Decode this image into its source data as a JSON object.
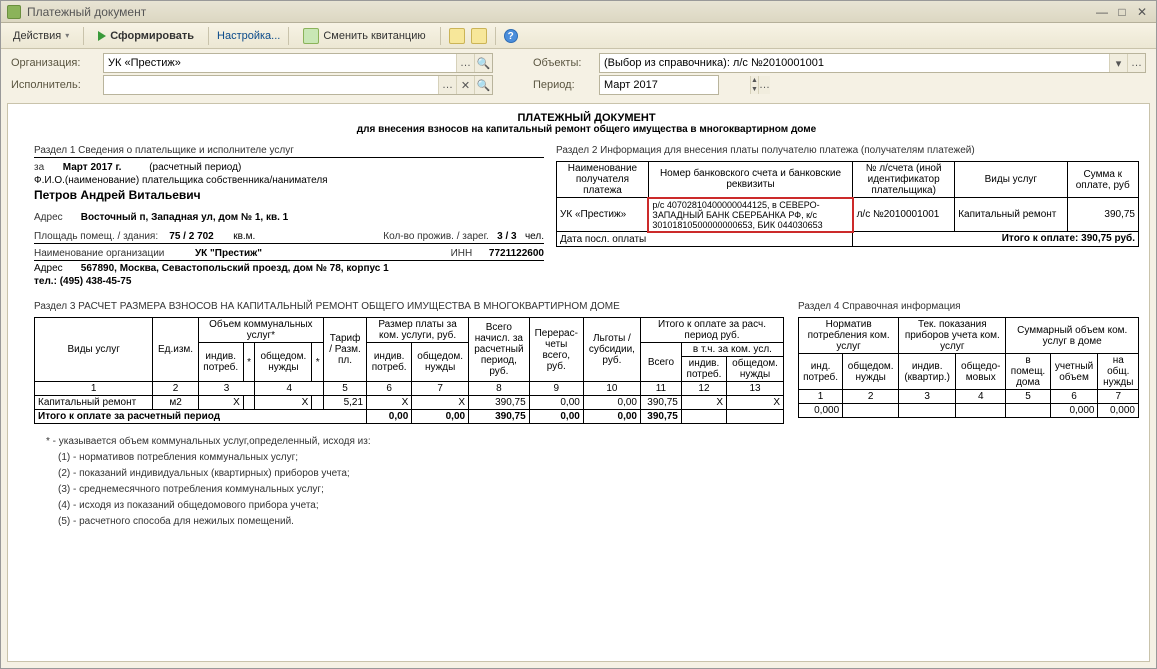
{
  "window": {
    "title": "Платежный документ"
  },
  "toolbar": {
    "actions": "Действия",
    "form": "Сформировать",
    "settings": "Настройка...",
    "change_receipt": "Сменить квитанцию"
  },
  "form": {
    "org_label": "Организация:",
    "org_value": "УК «Престиж»",
    "executor_label": "Исполнитель:",
    "executor_value": "",
    "objects_label": "Объекты:",
    "objects_value": "(Выбор из справочника): л/с №2010001001",
    "period_label": "Период:",
    "period_value": "Март 2017"
  },
  "doc": {
    "title": "ПЛАТЕЖНЫЙ ДОКУМЕНТ",
    "subtitle": "для внесения взносов на капитальный ремонт общего имущества в многоквартирном доме",
    "s1_title": "Раздел 1    Сведения о плательщике и исполнителе услуг",
    "s2_title": "Раздел 2     Информация для внесения платы получателю платежа (получателям платежей)",
    "s3_title": "Раздел 3   РАСЧЕТ РАЗМЕРА ВЗНОСОВ НА КАПИТАЛЬНЫЙ РЕМОНТ ОБЩЕГО ИМУЩЕСТВА В МНОГОКВАРТИРНОМ ДОМЕ",
    "s4_title": "Раздел 4     Справочная информация",
    "payer": {
      "za": "за",
      "period": "Март 2017 г.",
      "period_note": "(расчетный период)",
      "fio_label": "Ф.И.О.(наименование) плательщика собственника/нанимателя",
      "fio": "Петров Андрей Витальевич",
      "addr_label": "Адрес",
      "addr": "Восточный п, Западная ул, дом № 1, кв. 1",
      "area_label": "Площадь помещ. / здания:",
      "area": "75 / 2 702",
      "area_unit": "кв.м.",
      "people_label": "Кол-во прожив. / зарег.",
      "people": "3 / 3",
      "people_unit": "чел.",
      "org_label": "Наименование организации",
      "org": "УК \"Престиж\"",
      "inn_label": "ИНН",
      "inn": "7721122600",
      "addr2_label": "Адрес",
      "addr2": "567890, Москва, Севастопольский проезд, дом № 78, корпус 1",
      "tel_label": "тел.:",
      "tel": "(495) 438-45-75"
    },
    "s2_table": {
      "h1": "Наименование получателя платежа",
      "h2": "Номер банковского счета и банковские реквизиты",
      "h3": "№ л/счета (иной идентификатор плательщика)",
      "h4": "Виды услуг",
      "h5": "Сумма к оплате, руб",
      "r1c1": "УК «Престиж»",
      "r1c2": "р/с 40702810400000044125, в СЕВЕРО-ЗАПАДНЫЙ БАНК СБЕРБАНКА РФ, к/с 30101810500000000653, БИК 044030653",
      "r1c3": "л/с №2010001001",
      "r1c4": "Капитальный ремонт",
      "r1c5": "390,75",
      "foot_l": "Дата посл. оплаты",
      "foot_r": "Итого к оплате: 390,75 руб."
    },
    "s3_table": {
      "h": [
        "Виды услуг",
        "Ед.изм.",
        "Объем коммунальных услуг*",
        "Тариф / Разм. пл.",
        "Размер платы за ком. услуги, руб.",
        "Всего начисл. за расчетный период, руб.",
        "Перерас-четы всего, руб.",
        "Льготы / субсидии, руб.",
        "Итого к оплате за расч. период руб."
      ],
      "sub_vol": [
        "индив. потреб.",
        "*",
        "общедом. нужды",
        "*"
      ],
      "sub_pay": [
        "индив. потреб.",
        "общедом. нужды"
      ],
      "sub_total": [
        "Всего",
        "в т.ч. за ком. усл."
      ],
      "sub_total2": [
        "индив. потреб.",
        "общедом. нужды"
      ],
      "nums": [
        "1",
        "2",
        "3",
        "4",
        "5",
        "6",
        "7",
        "8",
        "9",
        "10",
        "11",
        "12",
        "13"
      ],
      "row": [
        "Капитальный ремонт",
        "м2",
        "X",
        "",
        "X",
        "",
        "5,21",
        "X",
        "X",
        "390,75",
        "0,00",
        "0,00",
        "390,75",
        "X",
        "X"
      ],
      "total_label": "Итого к оплате за расчетный период",
      "totals": [
        "0,00",
        "0,00",
        "390,75",
        "0,00",
        "0,00",
        "390,75"
      ]
    },
    "s4_table": {
      "h": [
        "Норматив потребления ком. услуг",
        "Тек. показания приборов учета ком. услуг",
        "Суммарный объем ком. услуг в доме"
      ],
      "sub": [
        "инд. потреб.",
        "общедом. нужды",
        "индив. (квартир.)",
        "общедо-мовых",
        "в помещ. дома",
        "учетный объем",
        "на общ. нужды"
      ],
      "nums": [
        "1",
        "2",
        "3",
        "4",
        "5",
        "6",
        "7"
      ],
      "row": [
        "0,000",
        "",
        "",
        "",
        "",
        "0,000",
        "0,000"
      ]
    },
    "notes": {
      "star": "* - указывается объем коммунальных услуг,определенный, исходя из:",
      "n1": "(1) - нормативов потребления коммунальных услуг;",
      "n2": "(2) - показаний индивидуальных (квартирных) приборов учета;",
      "n3": "(3) - среднемесячного потребления коммунальных услуг;",
      "n4": "(4) - исходя из показаний общедомового прибора учета;",
      "n5": "(5) - расчетного способа для нежилых помещений."
    }
  }
}
